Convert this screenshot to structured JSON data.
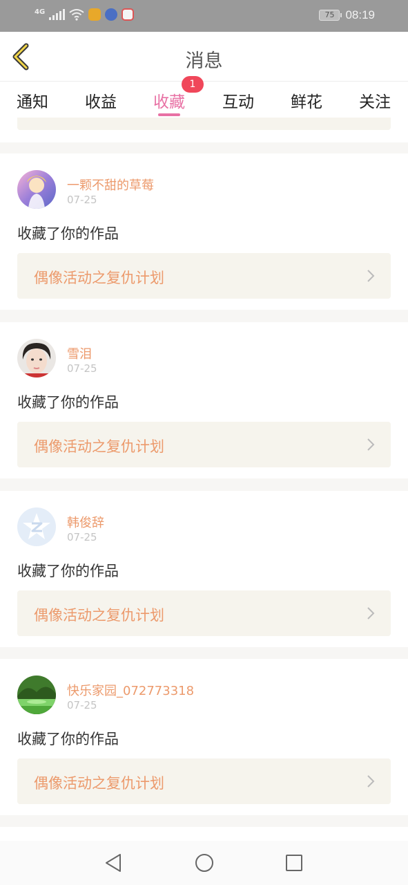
{
  "status": {
    "network": "4G",
    "battery": "75",
    "time": "08:19"
  },
  "header": {
    "title": "消息"
  },
  "tabs": [
    {
      "label": "通知"
    },
    {
      "label": "收益"
    },
    {
      "label": "收藏",
      "badge": "1"
    },
    {
      "label": "互动"
    },
    {
      "label": "鲜花"
    },
    {
      "label": "关注"
    }
  ],
  "active_tab": "收藏",
  "colors": {
    "accent_pink": "#e871a4",
    "name_orange": "#ec9a6c",
    "badge_red": "#f0475a",
    "link_bg": "#f6f4ed"
  },
  "messages": [
    {
      "user": "一颗不甜的草莓",
      "date": "07-25",
      "action": "收藏了你的作品",
      "work": "偶像活动之复仇计划",
      "avatar": "anime-avatar"
    },
    {
      "user": "雪泪",
      "date": "07-25",
      "action": "收藏了你的作品",
      "work": "偶像活动之复仇计划",
      "avatar": "child-photo-avatar"
    },
    {
      "user": "韩俊辞",
      "date": "07-25",
      "action": "收藏了你的作品",
      "work": "偶像活动之复仇计划",
      "avatar": "qzone-default-avatar"
    },
    {
      "user": "快乐家园_072773318",
      "date": "07-25",
      "action": "收藏了你的作品",
      "work": "偶像活动之复仇计划",
      "avatar": "landscape-avatar"
    }
  ]
}
